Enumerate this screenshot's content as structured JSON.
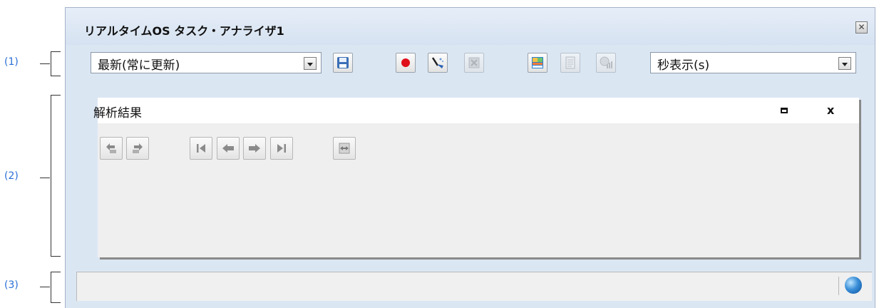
{
  "window": {
    "title": "リアルタイムOS タスク・アナライザ1",
    "close_icon": "close-icon"
  },
  "callouts": {
    "toolbar": "(1)",
    "analysis": "(2)",
    "status": "(3)"
  },
  "toolbar": {
    "mode_select": {
      "selected": "最新(常に更新)"
    },
    "unit_select": {
      "selected": "秒表示(s)"
    },
    "buttons": [
      {
        "icon": "save-icon",
        "enabled": true
      },
      {
        "icon": "record-icon",
        "enabled": true
      },
      {
        "icon": "clear-icon",
        "enabled": true
      },
      {
        "icon": "stop-icon",
        "enabled": false
      },
      {
        "icon": "layout-icon",
        "enabled": true
      },
      {
        "icon": "document-icon",
        "enabled": false
      },
      {
        "icon": "chart-icon",
        "enabled": false
      }
    ]
  },
  "panel": {
    "title": "解析結果",
    "buttons": [
      {
        "icon": "undo-icon"
      },
      {
        "icon": "redo-icon"
      },
      {
        "icon": "first-icon"
      },
      {
        "icon": "previous-icon"
      },
      {
        "icon": "next-icon"
      },
      {
        "icon": "last-icon"
      },
      {
        "icon": "sync-icon"
      }
    ]
  },
  "statusbar": {
    "icon": "connection-status-icon"
  },
  "colors": {
    "callout": "#2a6fd6",
    "window_bg": "#dbe6f3",
    "record": "#e0101a"
  }
}
